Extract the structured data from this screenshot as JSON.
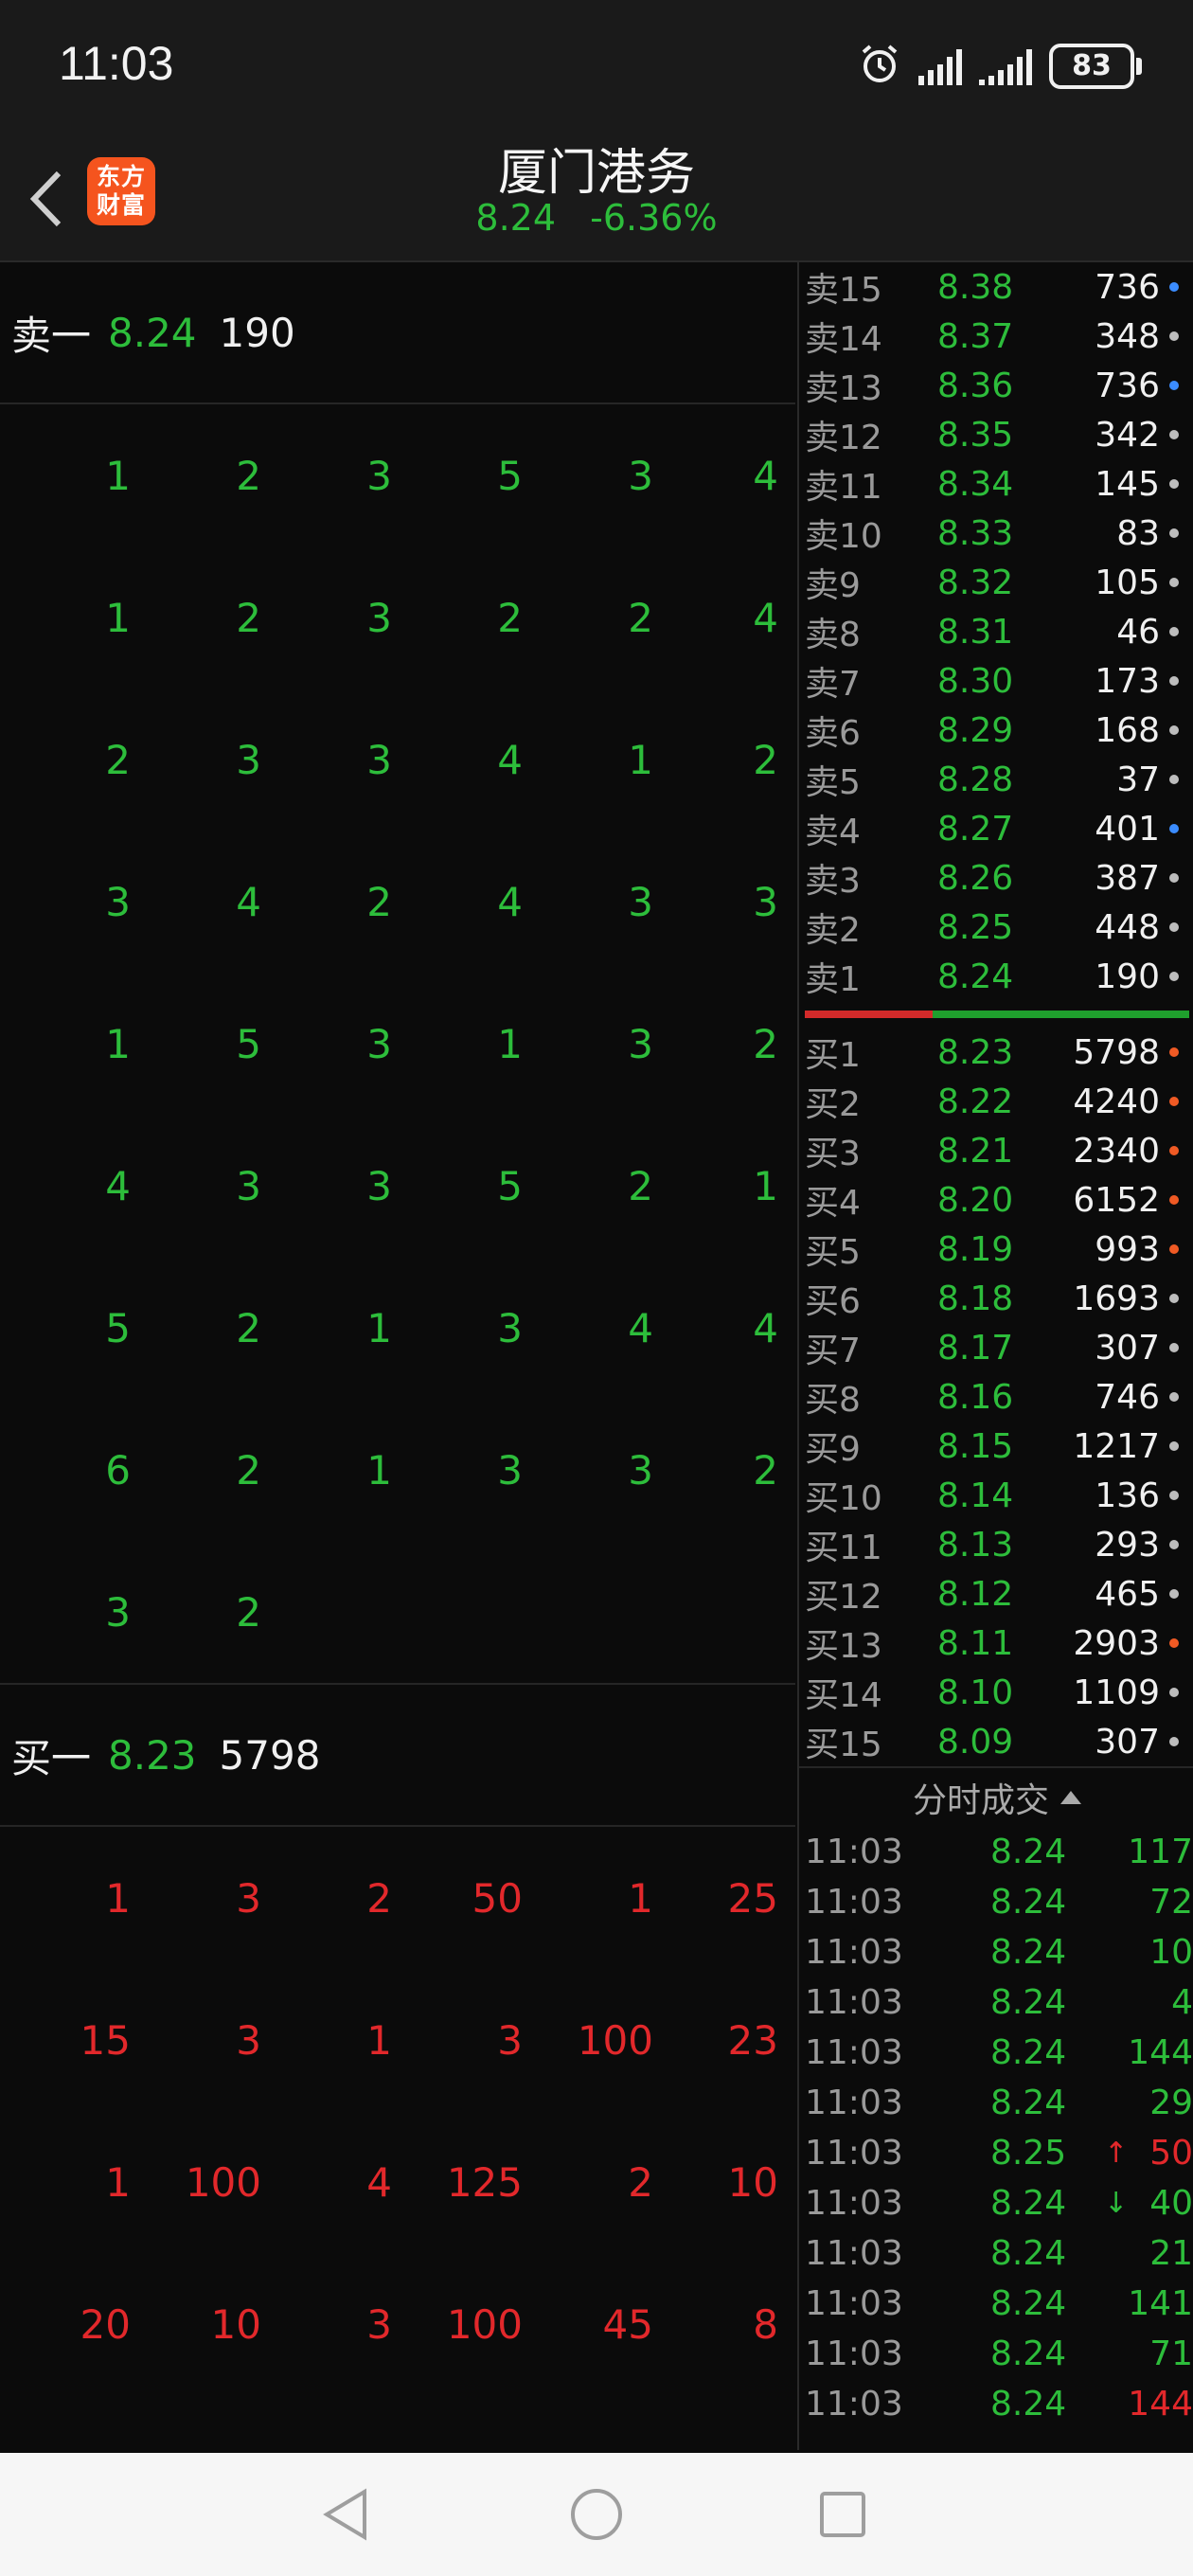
{
  "status": {
    "time": "11:03",
    "battery": "83"
  },
  "header": {
    "logo_line1": "东方",
    "logo_line2": "财富",
    "title": "厦门港务",
    "price": "8.24",
    "change": "-6.36%"
  },
  "sell_one": {
    "label": "卖一",
    "price": "8.24",
    "volume": "190"
  },
  "sell_grid": [
    [
      "1",
      "2",
      "3",
      "5",
      "3",
      "4"
    ],
    [
      "1",
      "2",
      "3",
      "2",
      "2",
      "4"
    ],
    [
      "2",
      "3",
      "3",
      "4",
      "1",
      "2"
    ],
    [
      "3",
      "4",
      "2",
      "4",
      "3",
      "3"
    ],
    [
      "1",
      "5",
      "3",
      "1",
      "3",
      "2"
    ],
    [
      "4",
      "3",
      "3",
      "5",
      "2",
      "1"
    ],
    [
      "5",
      "2",
      "1",
      "3",
      "4",
      "4"
    ],
    [
      "6",
      "2",
      "1",
      "3",
      "3",
      "2"
    ],
    [
      "3",
      "2",
      "",
      "",
      "",
      ""
    ]
  ],
  "buy_one": {
    "label": "买一",
    "price": "8.23",
    "volume": "5798"
  },
  "buy_grid": [
    [
      "1",
      "3",
      "2",
      "50",
      "1",
      "25"
    ],
    [
      "15",
      "3",
      "1",
      "3",
      "100",
      "23"
    ],
    [
      "1",
      "100",
      "4",
      "125",
      "2",
      "10"
    ],
    [
      "20",
      "10",
      "3",
      "100",
      "45",
      "8"
    ]
  ],
  "ask_levels": [
    {
      "label": "卖15",
      "price": "8.38",
      "volume": "736",
      "dot": "blue"
    },
    {
      "label": "卖14",
      "price": "8.37",
      "volume": "348",
      "dot": "gray"
    },
    {
      "label": "卖13",
      "price": "8.36",
      "volume": "736",
      "dot": "blue"
    },
    {
      "label": "卖12",
      "price": "8.35",
      "volume": "342",
      "dot": "gray"
    },
    {
      "label": "卖11",
      "price": "8.34",
      "volume": "145",
      "dot": "gray"
    },
    {
      "label": "卖10",
      "price": "8.33",
      "volume": "83",
      "dot": "gray"
    },
    {
      "label": "卖9",
      "price": "8.32",
      "volume": "105",
      "dot": "gray"
    },
    {
      "label": "卖8",
      "price": "8.31",
      "volume": "46",
      "dot": "gray"
    },
    {
      "label": "卖7",
      "price": "8.30",
      "volume": "173",
      "dot": "gray"
    },
    {
      "label": "卖6",
      "price": "8.29",
      "volume": "168",
      "dot": "gray"
    },
    {
      "label": "卖5",
      "price": "8.28",
      "volume": "37",
      "dot": "gray"
    },
    {
      "label": "卖4",
      "price": "8.27",
      "volume": "401",
      "dot": "blue"
    },
    {
      "label": "卖3",
      "price": "8.26",
      "volume": "387",
      "dot": "gray"
    },
    {
      "label": "卖2",
      "price": "8.25",
      "volume": "448",
      "dot": "gray"
    },
    {
      "label": "卖1",
      "price": "8.24",
      "volume": "190",
      "dot": "gray"
    }
  ],
  "bid_levels": [
    {
      "label": "买1",
      "price": "8.23",
      "volume": "5798",
      "dot": "orange"
    },
    {
      "label": "买2",
      "price": "8.22",
      "volume": "4240",
      "dot": "orange"
    },
    {
      "label": "买3",
      "price": "8.21",
      "volume": "2340",
      "dot": "orange"
    },
    {
      "label": "买4",
      "price": "8.20",
      "volume": "6152",
      "dot": "orange"
    },
    {
      "label": "买5",
      "price": "8.19",
      "volume": "993",
      "dot": "orange"
    },
    {
      "label": "买6",
      "price": "8.18",
      "volume": "1693",
      "dot": "gray"
    },
    {
      "label": "买7",
      "price": "8.17",
      "volume": "307",
      "dot": "gray"
    },
    {
      "label": "买8",
      "price": "8.16",
      "volume": "746",
      "dot": "gray"
    },
    {
      "label": "买9",
      "price": "8.15",
      "volume": "1217",
      "dot": "gray"
    },
    {
      "label": "买10",
      "price": "8.14",
      "volume": "136",
      "dot": "gray"
    },
    {
      "label": "买11",
      "price": "8.13",
      "volume": "293",
      "dot": "gray"
    },
    {
      "label": "买12",
      "price": "8.12",
      "volume": "465",
      "dot": "gray"
    },
    {
      "label": "买13",
      "price": "8.11",
      "volume": "2903",
      "dot": "orange"
    },
    {
      "label": "买14",
      "price": "8.10",
      "volume": "1109",
      "dot": "gray"
    },
    {
      "label": "买15",
      "price": "8.09",
      "volume": "307",
      "dot": "gray"
    }
  ],
  "trades_header": "分时成交",
  "trades": [
    {
      "time": "11:03",
      "price": "8.24",
      "arrow": "",
      "volume": "117",
      "side": "green"
    },
    {
      "time": "11:03",
      "price": "8.24",
      "arrow": "",
      "volume": "72",
      "side": "green"
    },
    {
      "time": "11:03",
      "price": "8.24",
      "arrow": "",
      "volume": "10",
      "side": "green"
    },
    {
      "time": "11:03",
      "price": "8.24",
      "arrow": "",
      "volume": "4",
      "side": "green"
    },
    {
      "time": "11:03",
      "price": "8.24",
      "arrow": "",
      "volume": "144",
      "side": "green"
    },
    {
      "time": "11:03",
      "price": "8.24",
      "arrow": "",
      "volume": "29",
      "side": "green"
    },
    {
      "time": "11:03",
      "price": "8.25",
      "arrow": "↑",
      "volume": "50",
      "side": "red"
    },
    {
      "time": "11:03",
      "price": "8.24",
      "arrow": "↓",
      "volume": "40",
      "side": "green"
    },
    {
      "time": "11:03",
      "price": "8.24",
      "arrow": "",
      "volume": "21",
      "side": "green"
    },
    {
      "time": "11:03",
      "price": "8.24",
      "arrow": "",
      "volume": "141",
      "side": "green"
    },
    {
      "time": "11:03",
      "price": "8.24",
      "arrow": "",
      "volume": "71",
      "side": "green"
    },
    {
      "time": "11:03",
      "price": "8.24",
      "arrow": "",
      "volume": "144",
      "side": "red"
    }
  ],
  "colors": {
    "up": "#e2282b",
    "down": "#2dbd3b",
    "brand": "#f5541e"
  }
}
